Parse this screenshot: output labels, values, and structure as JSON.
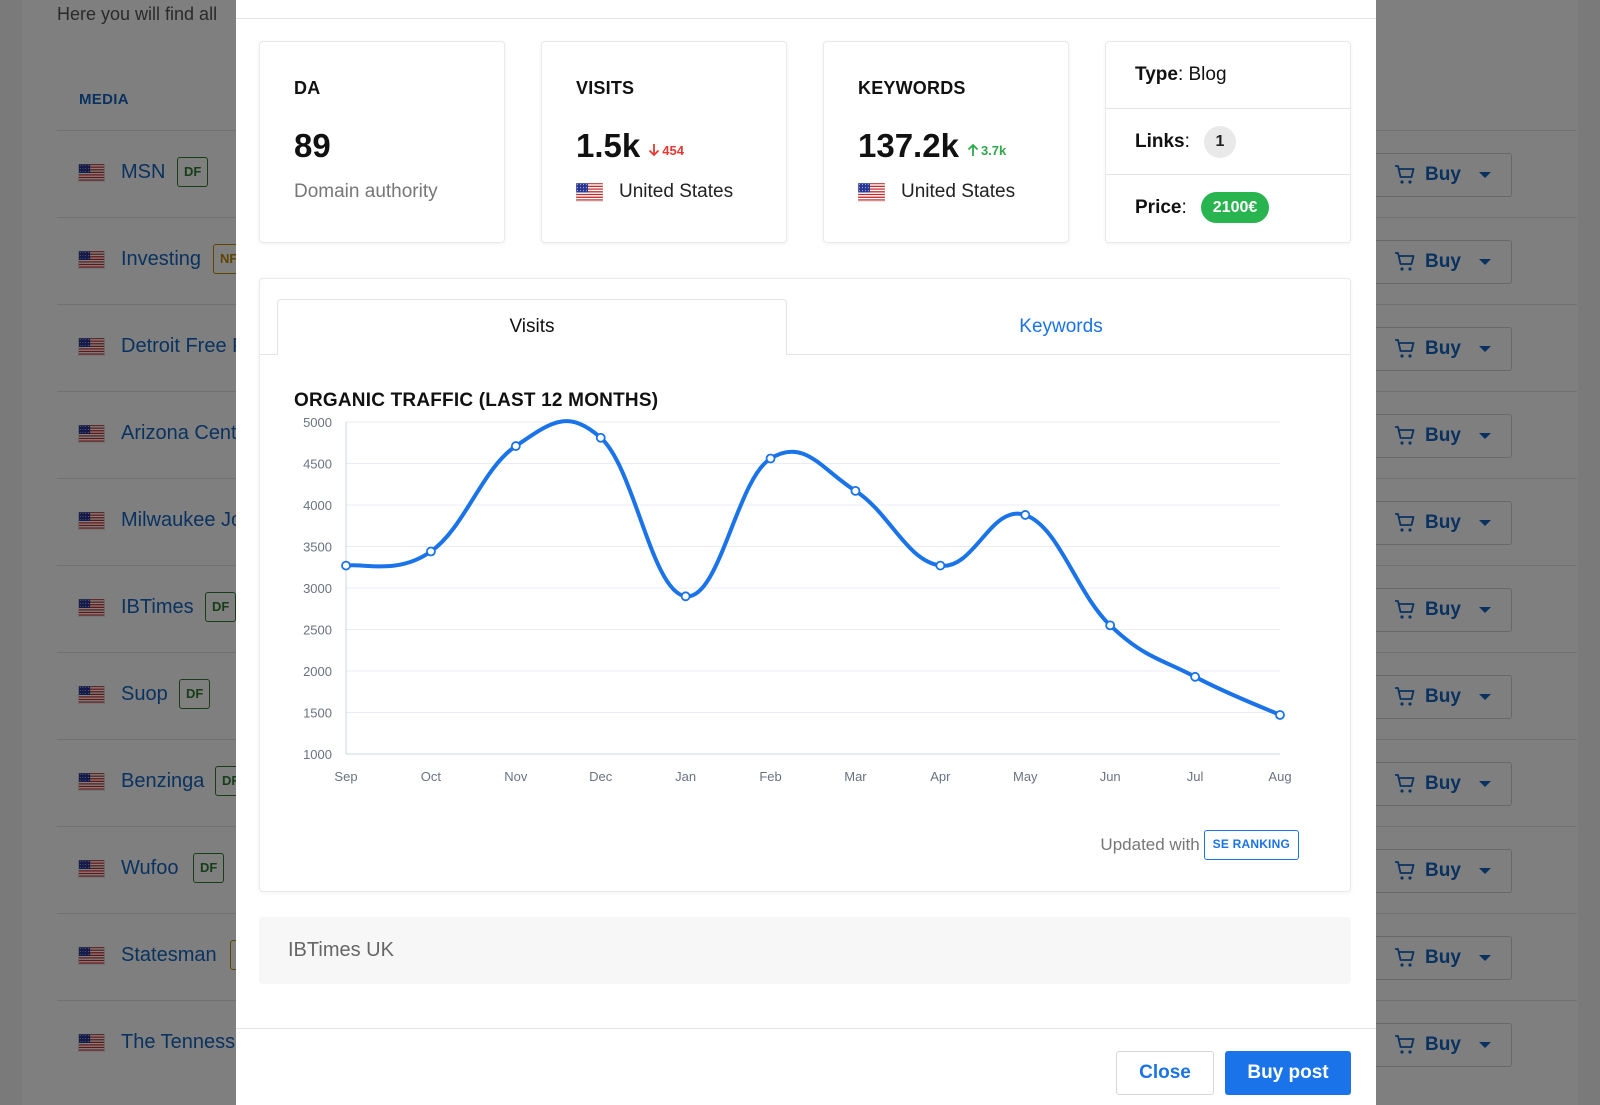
{
  "background": {
    "intro_text": "Here you will find all",
    "table_header": "MEDIA",
    "buy_label": "Buy",
    "rows": [
      {
        "name": "MSN",
        "badge": "DF",
        "badge_type": "df"
      },
      {
        "name": "Investing",
        "badge": "NF",
        "badge_type": "nf"
      },
      {
        "name": "Detroit Free P",
        "badge": "",
        "badge_type": ""
      },
      {
        "name": "Arizona Cent",
        "badge": "",
        "badge_type": ""
      },
      {
        "name": "Milwaukee Jo",
        "badge": "",
        "badge_type": ""
      },
      {
        "name": "IBTimes",
        "badge": "DF",
        "badge_type": "df"
      },
      {
        "name": "Suop",
        "badge": "DF",
        "badge_type": "df"
      },
      {
        "name": "Benzinga",
        "badge": "DF",
        "badge_type": "df"
      },
      {
        "name": "Wufoo",
        "badge": "DF",
        "badge_type": "df"
      },
      {
        "name": "Statesman",
        "badge": "",
        "badge_type": "nf"
      },
      {
        "name": "The Tenness",
        "badge": "",
        "badge_type": ""
      }
    ]
  },
  "modal": {
    "da": {
      "label": "DA",
      "value": "89",
      "sub": "Domain authority"
    },
    "visits": {
      "label": "VISITS",
      "value": "1.5k",
      "delta": "454",
      "delta_dir": "down",
      "country": "United States"
    },
    "keywords": {
      "label": "KEYWORDS",
      "value": "137.2k",
      "delta": "3.7k",
      "delta_dir": "up",
      "country": "United States"
    },
    "info": {
      "type_label": "Type",
      "type_value": "Blog",
      "links_label": "Links",
      "links_value": "1",
      "price_label": "Price",
      "price_value": "2100€"
    },
    "tabs": [
      {
        "label": "Visits",
        "active": true
      },
      {
        "label": "Keywords",
        "active": false
      }
    ],
    "updated_text": "Updated with",
    "se_badge": "SE RANKING",
    "description": "IBTimes UK",
    "close_label": "Close",
    "buy_post_label": "Buy post"
  },
  "colors": {
    "accent": "#1a73e8",
    "link": "#1565c0",
    "price_green": "#28b44f",
    "delta_down": "#e53935",
    "delta_up": "#2ea84a",
    "line": "#1a73e8"
  },
  "chart_data": {
    "type": "line",
    "title": "ORGANIC TRAFFIC (LAST 12 MONTHS)",
    "categories": [
      "Sep",
      "Oct",
      "Nov",
      "Dec",
      "Jan",
      "Feb",
      "Mar",
      "Apr",
      "May",
      "Jun",
      "Jul",
      "Aug"
    ],
    "series": [
      {
        "values": [
          3270,
          3440,
          4710,
          4810,
          2900,
          4560,
          4170,
          3270,
          3880,
          2550,
          1930,
          1470
        ]
      }
    ],
    "ylim": [
      1000,
      5000
    ],
    "yticks": [
      1000,
      1500,
      2000,
      2500,
      3000,
      3500,
      4000,
      4500,
      5000
    ],
    "grid": true,
    "legend": "none"
  }
}
